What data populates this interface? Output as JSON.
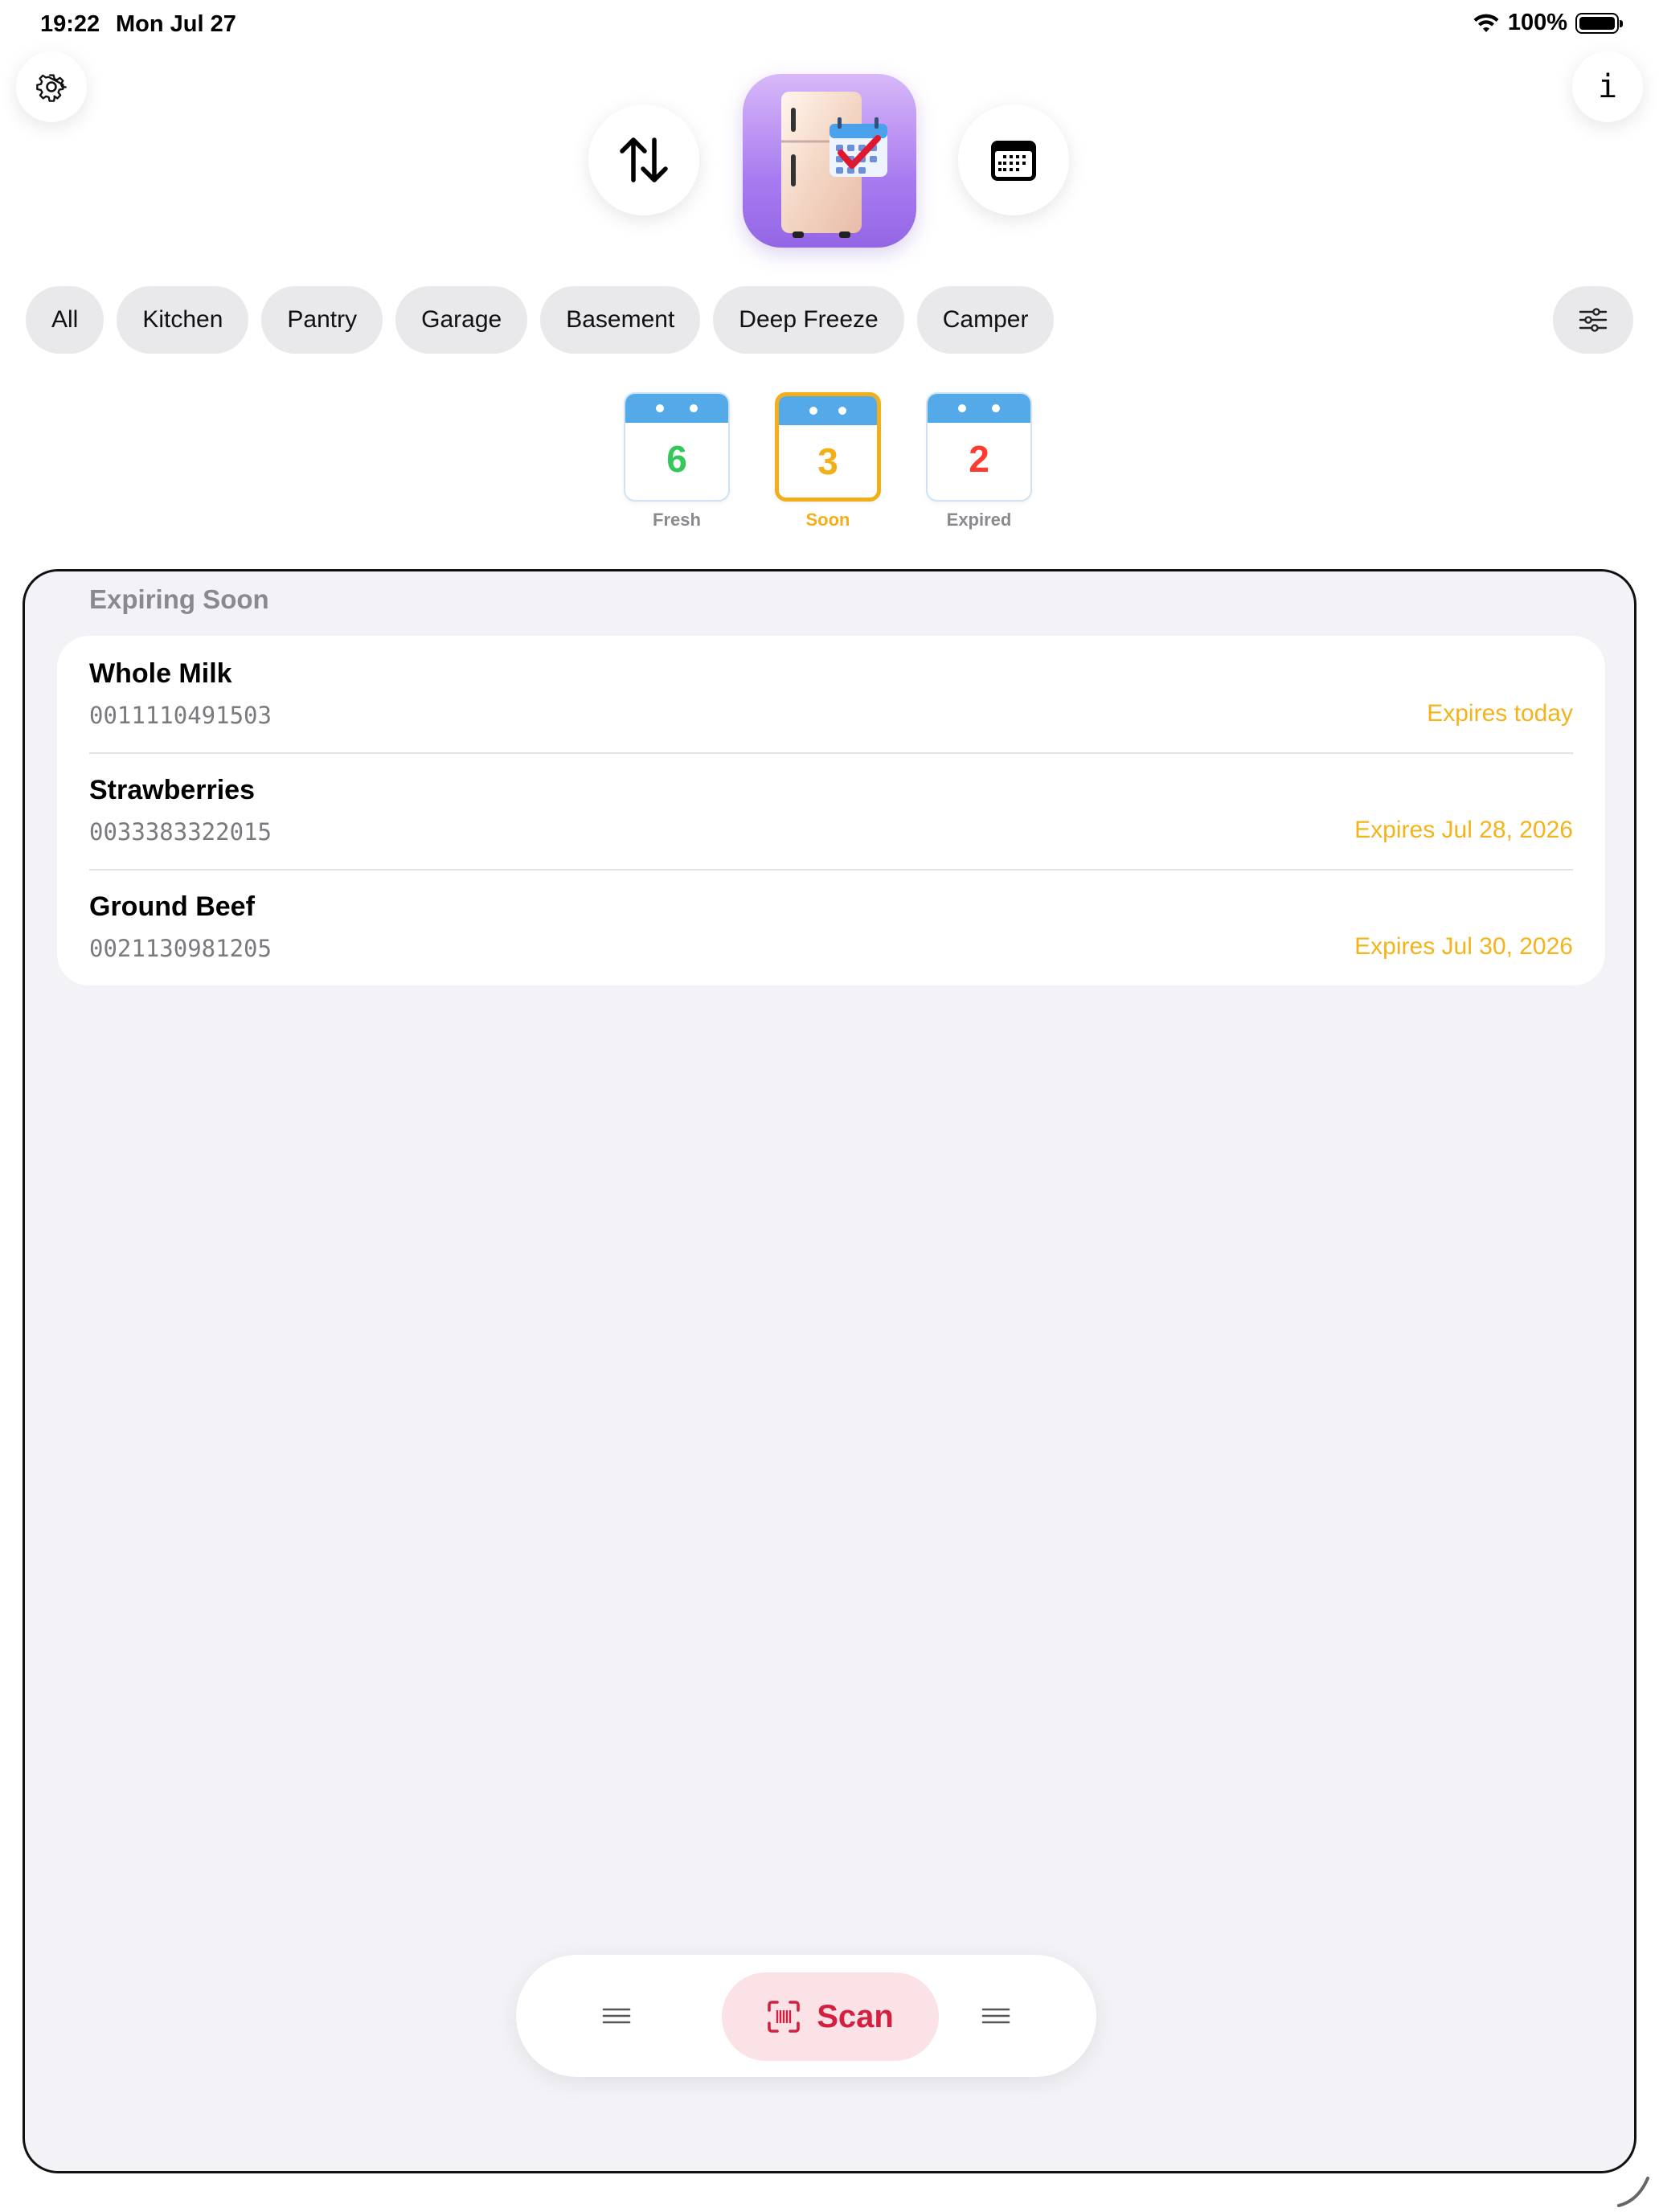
{
  "status_bar": {
    "time": "19:22",
    "date": "Mon Jul 27",
    "battery": "100%",
    "battery_level": 1.0
  },
  "header": {
    "settings_icon": "gear-icon",
    "info_icon": "info-icon",
    "info_label": "i",
    "sort_icon": "sort-arrows-icon",
    "calendar_icon": "calendar-icon",
    "app_icon": "fridge-calendar-app-icon"
  },
  "locations": {
    "chips": [
      "All",
      "Kitchen",
      "Pantry",
      "Garage",
      "Basement",
      "Deep Freeze",
      "Camper"
    ],
    "filter_icon": "sliders-icon"
  },
  "status_tiles": [
    {
      "count": "6",
      "label": "Fresh",
      "color": "#34c759",
      "label_color": "#8a8a8e",
      "selected": false
    },
    {
      "count": "3",
      "label": "Soon",
      "color": "#f4ae1a",
      "label_color": "#f4ae1a",
      "selected": true
    },
    {
      "count": "2",
      "label": "Expired",
      "color": "#ff3b30",
      "label_color": "#8a8a8e",
      "selected": false
    }
  ],
  "list": {
    "section_title": "Expiring Soon",
    "items": [
      {
        "name": "Whole Milk",
        "code": "0011110491503",
        "expires": "Expires today"
      },
      {
        "name": "Strawberries",
        "code": "0033383322015",
        "expires": "Expires Jul 28, 2026"
      },
      {
        "name": "Ground Beef",
        "code": "0021130981205",
        "expires": "Expires Jul 30, 2026"
      }
    ]
  },
  "toolbar": {
    "left_icon": "menu-lines-icon",
    "right_icon": "menu-lines-icon",
    "scan_label": "Scan",
    "scan_icon": "barcode-scan-icon"
  },
  "colors": {
    "accent_expiring": "#f2b41a",
    "scan_red": "#d42040",
    "sheet_bg": "#f2f2f7"
  }
}
